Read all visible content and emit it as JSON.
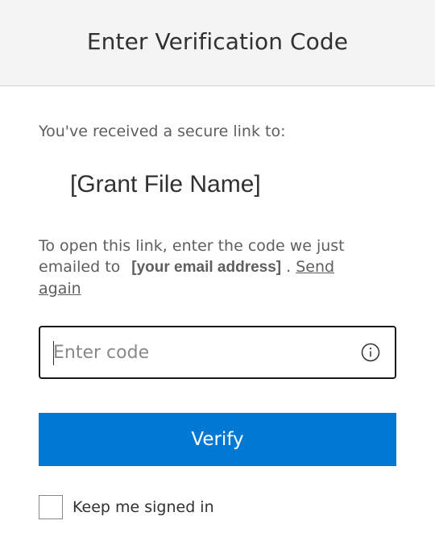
{
  "header": {
    "title": "Enter Verification Code"
  },
  "body": {
    "intro": "You've received a secure link to:",
    "file_name": "[Grant File Name]",
    "instructions_prefix": "To open this link, enter the code we just emailed to",
    "email": "[your email address]",
    "instructions_separator": ".",
    "send_again_label": "Send again"
  },
  "code_field": {
    "placeholder": "Enter code",
    "value": "",
    "info_icon": "info-circle-icon"
  },
  "verify_button": {
    "label": "Verify"
  },
  "keep_signed_in": {
    "label": "Keep me signed in",
    "checked": false
  },
  "colors": {
    "accent": "#0078d4",
    "header_bg": "#f4f4f4",
    "text": "#605e5c"
  }
}
